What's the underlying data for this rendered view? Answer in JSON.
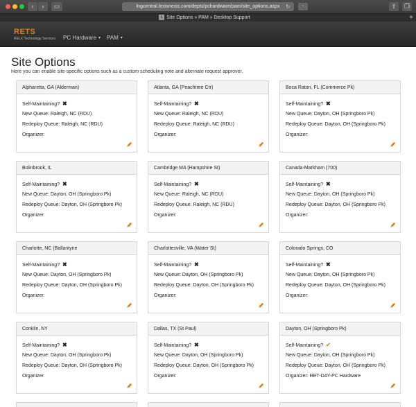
{
  "browser": {
    "url": "lngcentral.lexisnexis.com/depts/pchardware/pam/site_options.aspx",
    "tab_title": "Site Options » PAM » Desktop Support",
    "tab_favicon": "L"
  },
  "appnav": {
    "logo": "RETS",
    "logo_sub": "RELX Technology Services",
    "items": [
      {
        "label": "PC Hardware"
      },
      {
        "label": "PAM"
      }
    ]
  },
  "page": {
    "title": "Site Options",
    "description": "Here you can enable site-specific options such as a custom scheduling note and alternate request approver."
  },
  "labels": {
    "self_maintaining": "Self-Maintaining?",
    "new_queue": "New Queue:",
    "redeploy_queue": "Redeploy Queue:",
    "organizer": "Organizer:"
  },
  "sites": [
    {
      "name": "Alpharetta, GA (Alderman)",
      "self_maintaining": false,
      "new_queue": "Raleigh, NC (RDU)",
      "redeploy_queue": "Raleigh, NC (RDU)",
      "organizer": ""
    },
    {
      "name": "Atlanta, GA (Peachtree Ctr)",
      "self_maintaining": false,
      "new_queue": "Raleigh, NC (RDU)",
      "redeploy_queue": "Raleigh, NC (RDU)",
      "organizer": ""
    },
    {
      "name": "Boca Raton, FL (Commerce Pk)",
      "self_maintaining": false,
      "new_queue": "Dayton, OH (Springboro Pk)",
      "redeploy_queue": "Dayton, OH (Springboro Pk)",
      "organizer": ""
    },
    {
      "name": "Bolinbrook, IL",
      "self_maintaining": false,
      "new_queue": "Dayton, OH (Springboro Pk)",
      "redeploy_queue": "Dayton, OH (Springboro Pk)",
      "organizer": ""
    },
    {
      "name": "Cambridge MA (Hampshire St)",
      "self_maintaining": false,
      "new_queue": "Raleigh, NC (RDU)",
      "redeploy_queue": "Raleigh, NC (RDU)",
      "organizer": ""
    },
    {
      "name": "Canada-Markham (700)",
      "self_maintaining": false,
      "new_queue": "Dayton, OH (Springboro Pk)",
      "redeploy_queue": "Dayton, OH (Springboro Pk)",
      "organizer": ""
    },
    {
      "name": "Charlotte, NC (Ballantyne",
      "self_maintaining": false,
      "new_queue": "Dayton, OH (Springboro Pk)",
      "redeploy_queue": "Dayton, OH (Springboro Pk)",
      "organizer": ""
    },
    {
      "name": "Charlottesville, VA (Water St)",
      "self_maintaining": false,
      "new_queue": "Dayton, OH (Springboro Pk)",
      "redeploy_queue": "Dayton, OH (Springboro Pk)",
      "organizer": ""
    },
    {
      "name": "Colorado Springs, CO",
      "self_maintaining": false,
      "new_queue": "Dayton, OH (Springboro Pk)",
      "redeploy_queue": "Dayton, OH (Springboro Pk)",
      "organizer": ""
    },
    {
      "name": "Conklin, NY",
      "self_maintaining": false,
      "new_queue": "Dayton, OH (Springboro Pk)",
      "redeploy_queue": "Dayton, OH (Springboro Pk)",
      "organizer": ""
    },
    {
      "name": "Dallas, TX (St Paul)",
      "self_maintaining": false,
      "new_queue": "Dayton, OH (Springboro Pk)",
      "redeploy_queue": "Dayton, OH (Springboro Pk)",
      "organizer": ""
    },
    {
      "name": "Dayton, OH (Springboro Pk)",
      "self_maintaining": true,
      "new_queue": "Dayton, OH (Springboro Pk)",
      "redeploy_queue": "Dayton, OH (Springboro Pk)",
      "organizer": "RET-DAY-PC Hardware"
    }
  ],
  "colors": {
    "accent": "#e07d1a",
    "nav_bg": "#2b2b2b",
    "card_header_bg": "#f3f3f3"
  },
  "icons": {
    "edit": "pencil-icon",
    "no": "x-icon",
    "yes": "check-icon"
  }
}
